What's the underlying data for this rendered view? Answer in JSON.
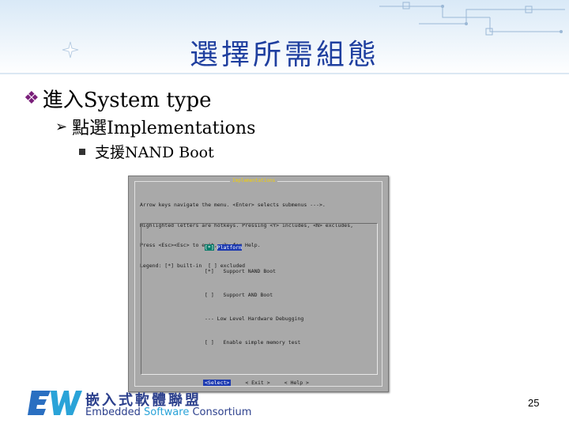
{
  "slide": {
    "title": "選擇所需組態",
    "page_number": "25"
  },
  "bullets": {
    "level1": "進入System type",
    "level2": "點選Implementations",
    "level3": "支援NAND Boot"
  },
  "terminal": {
    "window_title": "Implementations",
    "help_lines": [
      "Arrow keys navigate the menu. <Enter> selects submenus --->.",
      "Highlighted letters are hotkeys. Pressing <Y> includes, <N> excludes,",
      "Press <Esc><Esc> to exit, <?> for Help.",
      "Legend: [*] built-in  [ ] excluded"
    ],
    "menu": [
      {
        "prefix": "[*]",
        "label": "Platform"
      },
      {
        "prefix": "[*]",
        "label": "Support NAND Boot"
      },
      {
        "prefix": "[ ]",
        "label": "Support AND Boot"
      },
      {
        "prefix": "---",
        "label": "Low Level Hardware Debugging"
      },
      {
        "prefix": "[ ]",
        "label": "Enable simple memory test"
      }
    ],
    "buttons": {
      "select": "<Select>",
      "exit": "< Exit >",
      "help": "< Help >"
    }
  },
  "footer": {
    "logo_cn": "嵌入式軟體聯盟",
    "logo_en_1": "Embedded ",
    "logo_en_2": "Software",
    "logo_en_3": " Consortium"
  },
  "colors": {
    "title": "#1f3f9f",
    "bullet_diamond": "#7a1f7a",
    "terminal_bg": "#a9a9a9",
    "highlight": "#1d3ab0"
  }
}
